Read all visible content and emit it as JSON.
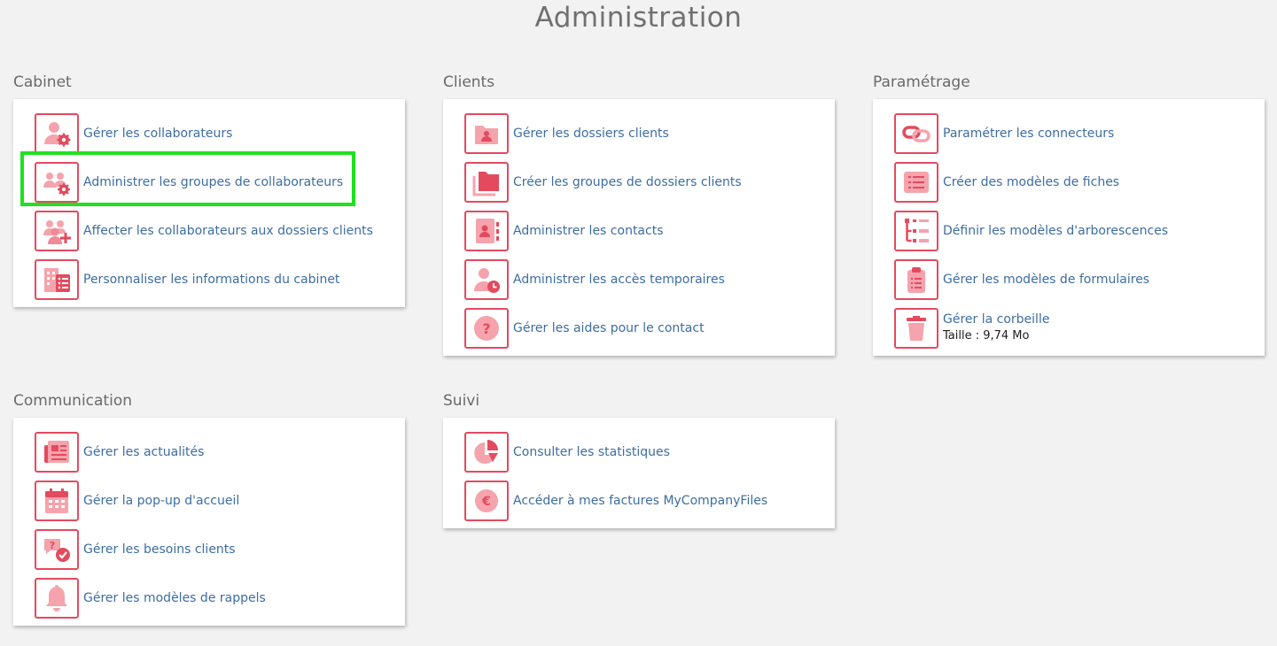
{
  "page": {
    "title": "Administration"
  },
  "colors": {
    "accent": "#e44a5e",
    "accent_light": "#f5a3ac",
    "link": "#3d6da1",
    "highlight": "#1fe11f",
    "background": "#f2f2f2"
  },
  "sections": {
    "cabinet": {
      "title": "Cabinet",
      "items": [
        {
          "label": "Gérer les collaborateurs",
          "icon": "user-gear-icon"
        },
        {
          "label": "Administrer les groupes de collaborateurs",
          "icon": "users-gear-icon"
        },
        {
          "label": "Affecter les collaborateurs aux dossiers clients",
          "icon": "users-plus-icon"
        },
        {
          "label": "Personnaliser les informations du cabinet",
          "icon": "building-list-icon"
        }
      ]
    },
    "clients": {
      "title": "Clients",
      "items": [
        {
          "label": "Gérer les dossiers clients",
          "icon": "folder-user-icon"
        },
        {
          "label": "Créer les groupes de dossiers clients",
          "icon": "folders-icon"
        },
        {
          "label": "Administrer les contacts",
          "icon": "contact-book-icon"
        },
        {
          "label": "Administrer les accès temporaires",
          "icon": "user-clock-icon"
        },
        {
          "label": "Gérer les aides pour le contact",
          "icon": "question-circle-icon"
        }
      ]
    },
    "parametrage": {
      "title": "Paramétrage",
      "items": [
        {
          "label": "Paramétrer les connecteurs",
          "icon": "link-icon"
        },
        {
          "label": "Créer des modèles de fiches",
          "icon": "list-card-icon"
        },
        {
          "label": "Définir les modèles d'arborescences",
          "icon": "tree-list-icon"
        },
        {
          "label": "Gérer les modèles de formulaires",
          "icon": "clipboard-icon"
        },
        {
          "label": "Gérer la corbeille",
          "sub": "Taille : 9,74 Mo",
          "icon": "trash-icon"
        }
      ]
    },
    "communication": {
      "title": "Communication",
      "items": [
        {
          "label": "Gérer les actualités",
          "icon": "newspaper-icon"
        },
        {
          "label": "Gérer la pop-up d'accueil",
          "icon": "calendar-icon"
        },
        {
          "label": "Gérer les besoins clients",
          "icon": "chat-question-icon"
        },
        {
          "label": "Gérer les modèles de rappels",
          "icon": "bell-icon"
        }
      ]
    },
    "suivi": {
      "title": "Suivi",
      "items": [
        {
          "label": "Consulter les statistiques",
          "icon": "pie-chart-icon"
        },
        {
          "label": "Accéder à mes factures MyCompanyFiles",
          "icon": "euro-icon"
        }
      ]
    }
  }
}
